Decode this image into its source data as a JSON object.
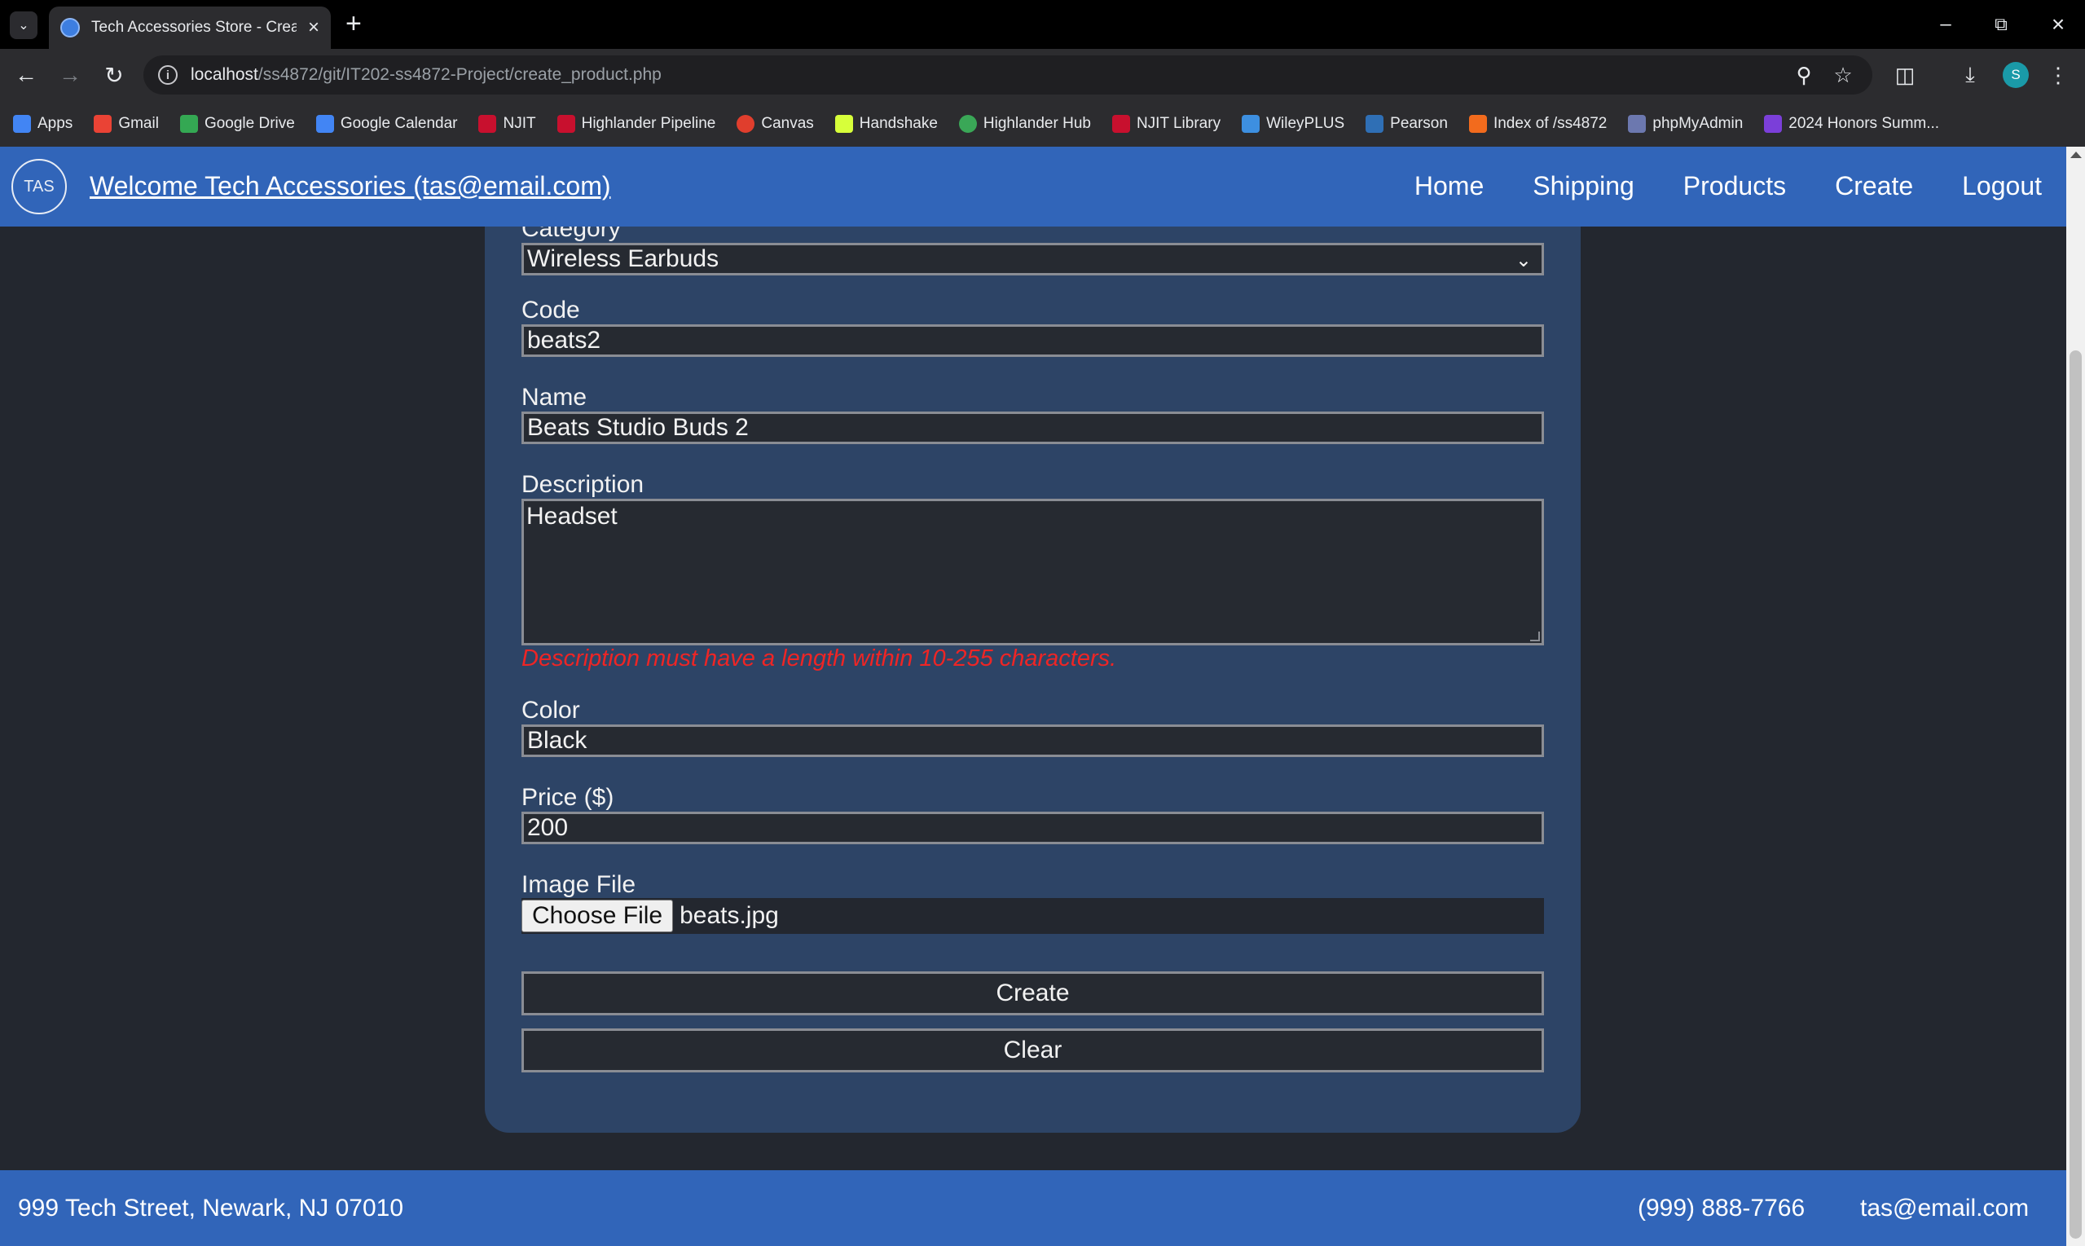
{
  "browser": {
    "tab_title": "Tech Accessories Store - Create",
    "url_host": "localhost",
    "url_path": "/ss4872/git/IT202-ss4872-Project/create_product.php",
    "profile_initial": "S"
  },
  "bookmarks": [
    {
      "label": "Apps",
      "color": "#4285f4"
    },
    {
      "label": "Gmail",
      "color": "#ea4335"
    },
    {
      "label": "Google Drive",
      "color": "#34a853"
    },
    {
      "label": "Google Calendar",
      "color": "#4285f4"
    },
    {
      "label": "NJIT",
      "color": "#c8102e"
    },
    {
      "label": "Highlander Pipeline",
      "color": "#c8102e"
    },
    {
      "label": "Canvas",
      "color": "#e03e2d"
    },
    {
      "label": "Handshake",
      "color": "#d7ff3a"
    },
    {
      "label": "Highlander Hub",
      "color": "#3aa757"
    },
    {
      "label": "NJIT Library",
      "color": "#c8102e"
    },
    {
      "label": "WileyPLUS",
      "color": "#3d8fe0"
    },
    {
      "label": "Pearson",
      "color": "#2f6fb5"
    },
    {
      "label": "Index of /ss4872",
      "color": "#f26b1d"
    },
    {
      "label": "phpMyAdmin",
      "color": "#6c78af"
    },
    {
      "label": "2024 Honors Summ...",
      "color": "#7b3fd9"
    }
  ],
  "header": {
    "logo": "TAS",
    "welcome": "Welcome Tech Accessories (tas@email.com)",
    "nav": [
      "Home",
      "Shipping",
      "Products",
      "Create",
      "Logout"
    ]
  },
  "form": {
    "category_label": "Category",
    "category_value": "Wireless Earbuds",
    "code_label": "Code",
    "code_value": "beats2",
    "name_label": "Name",
    "name_value": "Beats Studio Buds 2",
    "description_label": "Description",
    "description_value": "Headset",
    "description_error": "Description must have a length within 10-255 characters.",
    "color_label": "Color",
    "color_value": "Black",
    "price_label": "Price ($)",
    "price_value": "200",
    "image_label": "Image File",
    "choose_file": "Choose File",
    "file_name": "beats.jpg",
    "create_button": "Create",
    "clear_button": "Clear"
  },
  "footer": {
    "address": "999 Tech Street, Newark, NJ 07010",
    "phone": "(999) 888-7766",
    "email": "tas@email.com"
  },
  "colors": {
    "header_blue": "#3165b9",
    "card_bg": "#2d4466",
    "page_bg": "#23272f",
    "error_red": "#ee2525"
  }
}
